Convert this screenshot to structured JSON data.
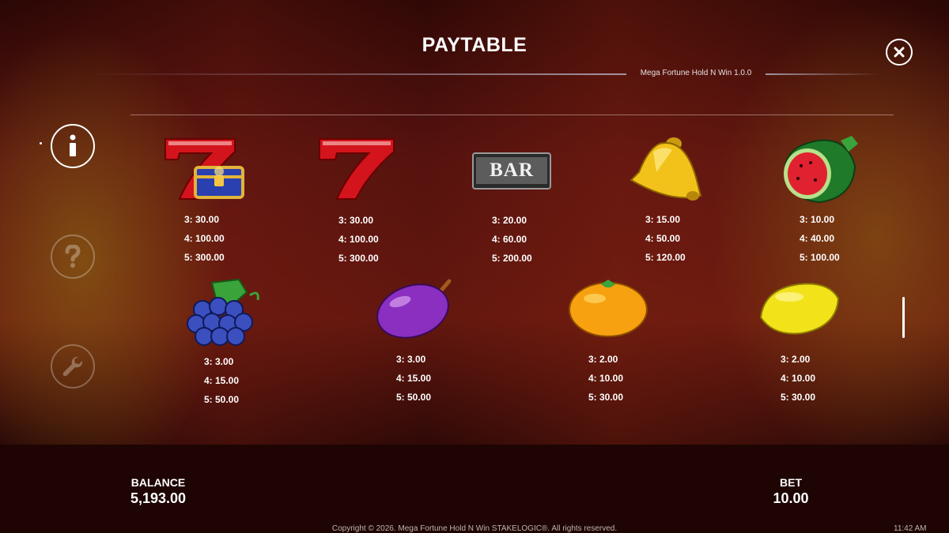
{
  "header": {
    "title": "PAYTABLE",
    "version": "Mega Fortune Hold N Win 1.0.0"
  },
  "sidebar": {
    "info_icon": "info-icon",
    "help_icon": "question-icon",
    "settings_icon": "wrench-icon"
  },
  "symbols": [
    {
      "name": "seven-chest",
      "pays": [
        "3: 30.00",
        "4: 100.00",
        "5: 300.00"
      ]
    },
    {
      "name": "seven",
      "pays": [
        "3: 30.00",
        "4: 100.00",
        "5: 300.00"
      ]
    },
    {
      "name": "bar",
      "label": "BAR",
      "pays": [
        "3: 20.00",
        "4: 60.00",
        "5: 200.00"
      ]
    },
    {
      "name": "bell",
      "pays": [
        "3: 15.00",
        "4: 50.00",
        "5: 120.00"
      ]
    },
    {
      "name": "watermelon",
      "pays": [
        "3: 10.00",
        "4: 40.00",
        "5: 100.00"
      ]
    },
    {
      "name": "grapes",
      "pays": [
        "3: 3.00",
        "4: 15.00",
        "5: 50.00"
      ]
    },
    {
      "name": "plum",
      "pays": [
        "3: 3.00",
        "4: 15.00",
        "5: 50.00"
      ]
    },
    {
      "name": "orange",
      "pays": [
        "3: 2.00",
        "4: 10.00",
        "5: 30.00"
      ]
    },
    {
      "name": "lemon",
      "pays": [
        "3: 2.00",
        "4: 10.00",
        "5: 30.00"
      ]
    }
  ],
  "footer": {
    "balance_label": "BALANCE",
    "balance_value": "5,193.00",
    "bet_label": "BET",
    "bet_value": "10.00",
    "copyright": "Copyright © 2026. Mega Fortune Hold N Win STAKELOGIC®. All rights reserved.",
    "time": "11:42 AM"
  },
  "colors": {
    "background": "#5a1410",
    "footer": "#1e0503",
    "text": "#ffffff"
  }
}
